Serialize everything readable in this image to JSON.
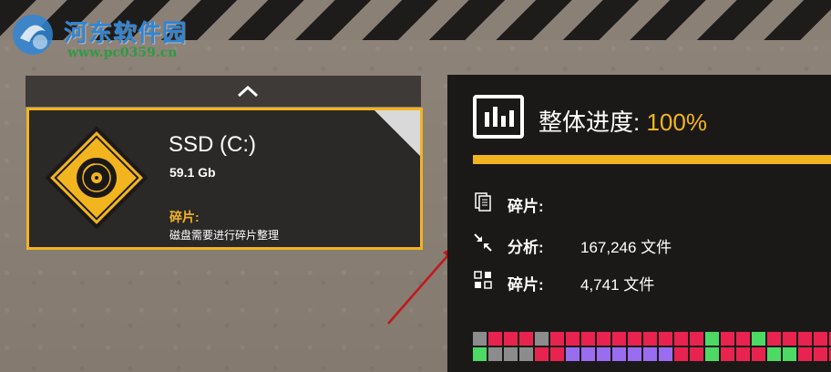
{
  "watermark": {
    "title": "河东软件园",
    "url": "www.pc0359.cn"
  },
  "drive": {
    "name": "SSD (C:)",
    "size": "59.1 Gb",
    "status_label": "碎片:",
    "status_text": "磁盘需要进行碎片整理"
  },
  "progress": {
    "label": "整体进度:",
    "value": "100%",
    "percent": 100
  },
  "stats": [
    {
      "icon": "document-icon",
      "label": "碎片:",
      "value": ""
    },
    {
      "icon": "analyze-icon",
      "label": "分析:",
      "value": "167,246 文件"
    },
    {
      "icon": "grid-icon",
      "label": "碎片:",
      "value": "4,741 文件"
    }
  ],
  "colors": {
    "accent": "#f2b51f",
    "panel": "#1b1918",
    "card": "#2b2828",
    "block_fragmented": "#e8234f",
    "block_free": "#4cd964",
    "block_system": "#9a6cf0",
    "block_unused": "#8c8c8c"
  },
  "block_map": [
    "u",
    "r",
    "r",
    "r",
    "u",
    "r",
    "r",
    "r",
    "r",
    "r",
    "r",
    "r",
    "r",
    "r",
    "r",
    "g",
    "r",
    "r",
    "g",
    "r",
    "r",
    "r",
    "r",
    "r",
    "g",
    "u",
    "u",
    "u",
    "r",
    "r",
    "p",
    "p",
    "p",
    "p",
    "p",
    "p",
    "p",
    "r",
    "r",
    "g",
    "r",
    "r",
    "r",
    "g",
    "g",
    "r",
    "r",
    "r"
  ]
}
